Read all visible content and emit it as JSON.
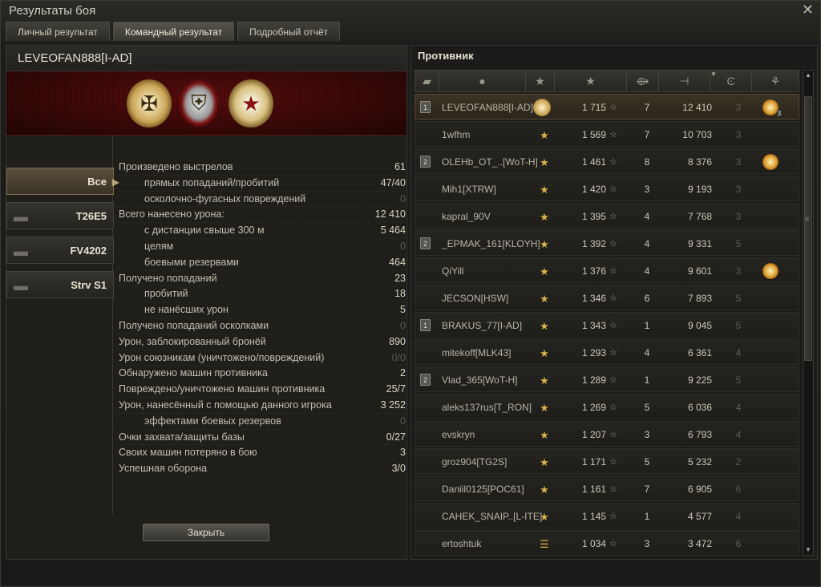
{
  "window": {
    "title": "Результаты боя",
    "close_glyph": "✕"
  },
  "tabs": [
    {
      "label": "Личный результат",
      "active": false
    },
    {
      "label": "Командный результат",
      "active": true
    },
    {
      "label": "Подробный отчёт",
      "active": false
    }
  ],
  "player": {
    "name": "LEVEOFAN888[I-AD]"
  },
  "banner_medals": [
    "shell-wreath-medal",
    "rank-shield-medal",
    "star-wreath-medal"
  ],
  "vehicles": [
    {
      "name": "Все",
      "selected": true
    },
    {
      "name": "T26E5",
      "selected": false
    },
    {
      "name": "FV4202",
      "selected": false
    },
    {
      "name": "Strv S1",
      "selected": false
    }
  ],
  "stats": [
    {
      "label": "Произведено выстрелов",
      "value": "61",
      "sub": false,
      "dim": false
    },
    {
      "label": "прямых попаданий/пробитий",
      "value": "47/40",
      "sub": true,
      "dim": false
    },
    {
      "label": "осколочно-фугасных повреждений",
      "value": "0",
      "sub": true,
      "dim": true
    },
    {
      "label": "Всего нанесено урона:",
      "value": "12 410",
      "sub": false,
      "dim": false
    },
    {
      "label": "с дистанции свыше 300 м",
      "value": "5 464",
      "sub": true,
      "dim": false
    },
    {
      "label": "целям",
      "value": "0",
      "sub": true,
      "dim": true
    },
    {
      "label": "боевыми резервами",
      "value": "464",
      "sub": true,
      "dim": false
    },
    {
      "label": "Получено попаданий",
      "value": "23",
      "sub": false,
      "dim": false
    },
    {
      "label": "пробитий",
      "value": "18",
      "sub": true,
      "dim": false
    },
    {
      "label": "не нанёсших урон",
      "value": "5",
      "sub": true,
      "dim": false
    },
    {
      "label": "Получено попаданий осколками",
      "value": "0",
      "sub": false,
      "dim": true
    },
    {
      "label": "Урон, заблокированный бронёй",
      "value": "890",
      "sub": false,
      "dim": false
    },
    {
      "label": "Урон союзникам (уничтожено/повреждений)",
      "value": "0/0",
      "sub": false,
      "dim": true
    },
    {
      "label": "Обнаружено машин противника",
      "value": "2",
      "sub": false,
      "dim": false
    },
    {
      "label": "Повреждено/уничтожено машин противника",
      "value": "25/7",
      "sub": false,
      "dim": false
    },
    {
      "label": "Урон, нанесённый с помощью данного игрока",
      "value": "3 252",
      "sub": false,
      "dim": false
    },
    {
      "label": "эффектами боевых резервов",
      "value": "0",
      "sub": true,
      "dim": true
    },
    {
      "label": "Очки захвата/защиты базы",
      "value": "0/27",
      "sub": false,
      "dim": false
    },
    {
      "label": "Своих машин потеряно в бою",
      "value": "3",
      "sub": false,
      "dim": false
    },
    {
      "label": "Успешная оборона",
      "value": "3/0",
      "sub": false,
      "dim": false
    }
  ],
  "close_button": "Закрыть",
  "enemy": {
    "header": "Противник",
    "columns": [
      "squad-icon",
      "player-icon",
      "rank-icon",
      "xp-star-icon",
      "kills-icon",
      "damage-icon",
      "tier-icon",
      "medal-icon"
    ],
    "rows": [
      {
        "squad": "1",
        "name": "LEVEOFAN888[I-AD]",
        "rank_type": "wreath",
        "xp": "1 715",
        "kills": "7",
        "damage": "12 410",
        "tier": "3",
        "medal": "3",
        "me": true
      },
      {
        "squad": "",
        "name": "1wfhm",
        "rank_type": "star",
        "xp": "1 569",
        "kills": "7",
        "damage": "10 703",
        "tier": "3",
        "medal": "",
        "me": false
      },
      {
        "squad": "2",
        "name": "OLEHb_OT_..[WoT-H]",
        "rank_type": "star",
        "xp": "1 461",
        "kills": "8",
        "damage": "8 376",
        "tier": "3",
        "medal": "1",
        "me": false
      },
      {
        "squad": "",
        "name": "Mih1[XTRW]",
        "rank_type": "star",
        "xp": "1 420",
        "kills": "3",
        "damage": "9 193",
        "tier": "3",
        "medal": "",
        "me": false
      },
      {
        "squad": "",
        "name": "kapral_90V",
        "rank_type": "star",
        "xp": "1 395",
        "kills": "4",
        "damage": "7 768",
        "tier": "3",
        "medal": "",
        "me": false
      },
      {
        "squad": "2",
        "name": "_EPMAK_161[KLOYH]",
        "rank_type": "star",
        "xp": "1 392",
        "kills": "4",
        "damage": "9 331",
        "tier": "5",
        "medal": "",
        "me": false
      },
      {
        "squad": "",
        "name": "QiYill",
        "rank_type": "star",
        "xp": "1 376",
        "kills": "4",
        "damage": "9 601",
        "tier": "3",
        "medal": "1",
        "me": false
      },
      {
        "squad": "",
        "name": "JECSON[HSW]",
        "rank_type": "star",
        "xp": "1 346",
        "kills": "6",
        "damage": "7 893",
        "tier": "5",
        "medal": "",
        "me": false
      },
      {
        "squad": "1",
        "name": "BRAKUS_77[I-AD]",
        "rank_type": "star",
        "xp": "1 343",
        "kills": "1",
        "damage": "9 045",
        "tier": "5",
        "medal": "",
        "me": false
      },
      {
        "squad": "",
        "name": "mitekoff[MLK43]",
        "rank_type": "star",
        "xp": "1 293",
        "kills": "4",
        "damage": "6 361",
        "tier": "4",
        "medal": "",
        "me": false
      },
      {
        "squad": "2",
        "name": "Vlad_365[WoT-H]",
        "rank_type": "star",
        "xp": "1 289",
        "kills": "1",
        "damage": "9 225",
        "tier": "5",
        "medal": "",
        "me": false
      },
      {
        "squad": "",
        "name": "aleks137rus[T_RON]",
        "rank_type": "star",
        "xp": "1 269",
        "kills": "5",
        "damage": "6 036",
        "tier": "4",
        "medal": "",
        "me": false
      },
      {
        "squad": "",
        "name": "evskryn",
        "rank_type": "star",
        "xp": "1 207",
        "kills": "3",
        "damage": "6 793",
        "tier": "4",
        "medal": "",
        "me": false
      },
      {
        "squad": "",
        "name": "groz904[TG2S]",
        "rank_type": "star",
        "xp": "1 171",
        "kills": "5",
        "damage": "5 232",
        "tier": "2",
        "medal": "",
        "me": false
      },
      {
        "squad": "",
        "name": "Daniil0125[POC61]",
        "rank_type": "star",
        "xp": "1 161",
        "kills": "7",
        "damage": "6 905",
        "tier": "6",
        "medal": "",
        "me": false
      },
      {
        "squad": "",
        "name": "CAHEK_SNAIP..[L-ITE]",
        "rank_type": "star",
        "xp": "1 145",
        "kills": "1",
        "damage": "4 577",
        "tier": "4",
        "medal": "",
        "me": false
      },
      {
        "squad": "",
        "name": "ertoshtuk",
        "rank_type": "bars",
        "xp": "1 034",
        "kills": "3",
        "damage": "3 472",
        "tier": "6",
        "medal": "",
        "me": false
      }
    ]
  }
}
